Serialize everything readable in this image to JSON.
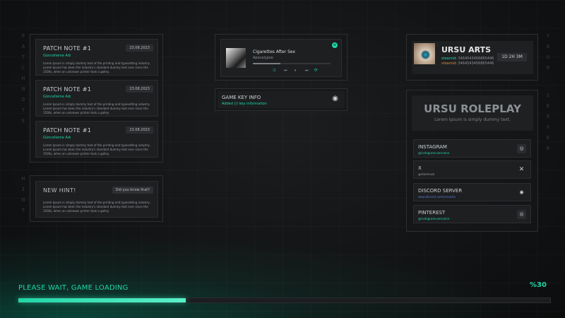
{
  "side_letters": {
    "left_top": [
      "P",
      "A",
      "T",
      "C",
      "H",
      "N",
      "O",
      "T",
      "E"
    ],
    "left_bottom": [
      "H",
      "I",
      "N",
      "T"
    ],
    "right_top": [
      "Y",
      "O",
      "U",
      "R"
    ],
    "right_bottom": [
      "S",
      "E",
      "R",
      "V",
      "E",
      "R"
    ]
  },
  "patch_notes": [
    {
      "title": "PATCH NOTE #1",
      "author": "Güncelleme Adı",
      "date": "23.08.2023",
      "text": "Lorem Ipsum is simply dummy text of the printing and typesetting industry. Lorem Ipsum has been the industry's standard dummy text ever since the 1500s, when an unknown printer took a galley."
    },
    {
      "title": "PATCH NOTE #1",
      "author": "Güncelleme Adı",
      "date": "23.08.2023",
      "text": "Lorem Ipsum is simply dummy text of the printing and typesetting industry. Lorem Ipsum has been the industry's standard dummy text ever since the 1500s, when an unknown printer took a galley."
    },
    {
      "title": "PATCH NOTE #1",
      "author": "Güncelleme Adı",
      "date": "23.08.2023",
      "text": "Lorem Ipsum is simply dummy text of the printing and typesetting industry. Lorem Ipsum has been the industry's standard dummy text ever since the 1500s, when an unknown printer took a galley."
    }
  ],
  "hint": {
    "title": "NEW HINT!",
    "button": "Did you know that?",
    "text": "Lorem Ipsum is simply dummy text of the printing and typesetting industry. Lorem Ipsum has been the industry's standard dummy text ever since the 1500s, when an unknown printer took a galley."
  },
  "music": {
    "song": "Cigarettes After Sex",
    "artist": "Apocalypse",
    "progress": 0.35,
    "controls": [
      "shuffle-icon",
      "previous-icon",
      "pause-icon",
      "next-icon",
      "repeat-icon"
    ]
  },
  "game_key": {
    "title": "GAME KEY INFO",
    "subtitle": "Added (/) key information"
  },
  "profile": {
    "name": "URSU ARTS",
    "ids": [
      {
        "label": "steamid",
        "value": "3464543456865446"
      },
      {
        "label": "steamid",
        "value": "3464543456865446"
      }
    ],
    "playtime": "1D 2H 3M"
  },
  "server": {
    "name": "URSU ROLEPLAY",
    "tagline": "Lorem Ipsum is simply dummy text."
  },
  "socials": [
    {
      "name": "INSTAGRAM",
      "handle": "@instagramusername",
      "icon": "instagram-icon",
      "glyph": "◎"
    },
    {
      "name": "X",
      "handle": "@elonmusk",
      "icon": "x-icon",
      "glyph": "✕"
    },
    {
      "name": "DISCORD SERVER",
      "handle": "www.discord.com/ursuarts",
      "icon": "discord-icon",
      "glyph": "◉"
    },
    {
      "name": "PINTEREST",
      "handle": "@instagramusername",
      "icon": "pinterest-icon",
      "glyph": "◎"
    }
  ],
  "loading": {
    "label": "PLEASE WAIT, GAME LOADING",
    "percent_text": "%30",
    "progress": 0.3
  },
  "colors": {
    "accent": "#1fd6a6",
    "panel": "#1d1f21",
    "background": "#121314"
  }
}
